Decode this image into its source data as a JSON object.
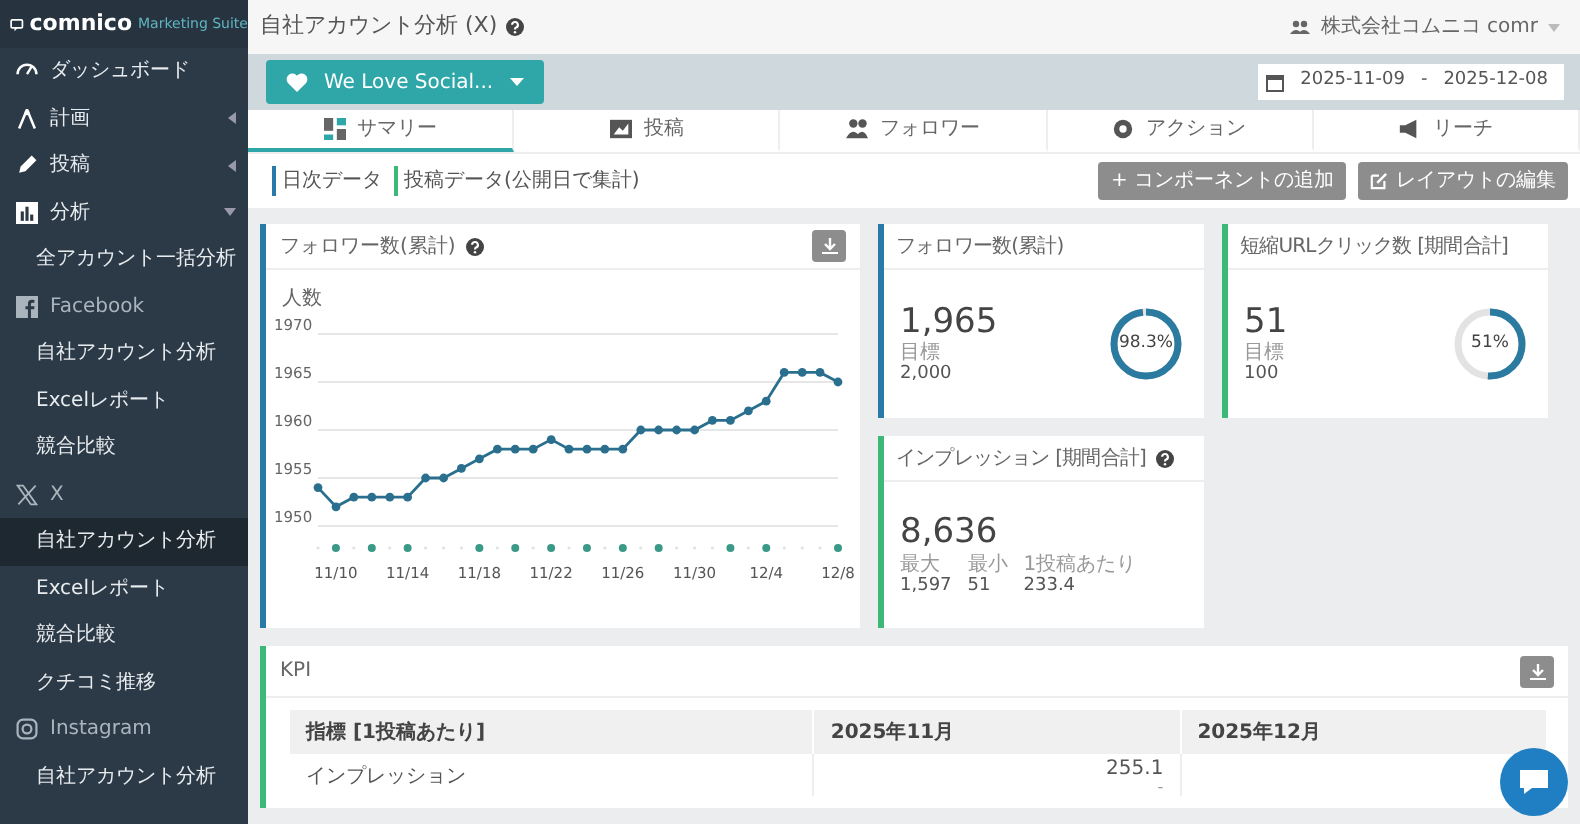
{
  "brand": {
    "name": "comnico",
    "product": "Marketing Suite"
  },
  "sidebar": {
    "items": [
      {
        "kind": "menu",
        "label": "ダッシュボード",
        "selected": false
      },
      {
        "kind": "menu",
        "label": "計画",
        "expanded": false,
        "selected": false
      },
      {
        "kind": "menu",
        "label": "投稿",
        "expanded": false,
        "selected": false
      },
      {
        "kind": "menu",
        "label": "分析",
        "expanded": true,
        "selected": false
      },
      {
        "kind": "sub",
        "label": "全アカウント一括分析",
        "selected": false
      },
      {
        "kind": "section",
        "label": "Facebook"
      },
      {
        "kind": "sub",
        "label": "自社アカウント分析",
        "selected": false
      },
      {
        "kind": "sub",
        "label": "Excelレポート",
        "selected": false
      },
      {
        "kind": "sub",
        "label": "競合比較",
        "selected": false
      },
      {
        "kind": "section",
        "label": "X"
      },
      {
        "kind": "sub",
        "label": "自社アカウント分析",
        "selected": true
      },
      {
        "kind": "sub",
        "label": "Excelレポート",
        "selected": false
      },
      {
        "kind": "sub",
        "label": "競合比較",
        "selected": false
      },
      {
        "kind": "sub",
        "label": "クチコミ推移",
        "selected": false
      },
      {
        "kind": "section",
        "label": "Instagram"
      },
      {
        "kind": "sub",
        "label": "自社アカウント分析",
        "selected": false
      }
    ]
  },
  "header": {
    "title": "自社アカウント分析 (X)",
    "company": "株式会社コムニコ comr"
  },
  "account_button": {
    "label": "We Love Social..."
  },
  "date_range": {
    "start": "2025-11-09",
    "separator": "-",
    "end": "2025-12-08"
  },
  "tabs": [
    {
      "label": "サマリー",
      "selected": true
    },
    {
      "label": "投稿",
      "selected": false
    },
    {
      "label": "フォロワー",
      "selected": false
    },
    {
      "label": "アクション",
      "selected": false
    },
    {
      "label": "リーチ",
      "selected": false
    }
  ],
  "legend": [
    {
      "label": "日次データ",
      "color": "#2a7aa8"
    },
    {
      "label": "投稿データ(公開日で集計)",
      "color": "#3cb878"
    }
  ],
  "actions": [
    {
      "kind": "add",
      "label": "+ コンポーネントの追加"
    },
    {
      "kind": "edit",
      "label": "レイアウトの編集"
    }
  ],
  "follower_chart": {
    "title": "フォロワー数(累計)",
    "color": "#2a7aa8",
    "posted": [
      false,
      true,
      false,
      true,
      false,
      true,
      false,
      false,
      false,
      true,
      false,
      true,
      false,
      true,
      false,
      true,
      false,
      true,
      false,
      true,
      false,
      false,
      false,
      true,
      false,
      true,
      false,
      false,
      false,
      true
    ],
    "chart_data": {
      "type": "line",
      "ylabel": "人数",
      "categories": [
        null,
        "11/10",
        null,
        null,
        null,
        "11/14",
        null,
        null,
        null,
        "11/18",
        null,
        null,
        null,
        "11/22",
        null,
        null,
        null,
        "11/26",
        null,
        null,
        null,
        "11/30",
        null,
        null,
        null,
        "12/4",
        null,
        null,
        null,
        "12/8"
      ],
      "series": [
        {
          "color": "#2a6f8e",
          "marker": true,
          "values": [
            1954,
            1952,
            1953,
            1953,
            1953,
            1953,
            1955,
            1955,
            1956,
            1957,
            1958,
            1958,
            1958,
            1959,
            1958,
            1958,
            1958,
            1958,
            1960,
            1960,
            1960,
            1960,
            1961,
            1961,
            1962,
            1963,
            1966,
            1966,
            1966,
            1965
          ]
        }
      ],
      "grid": true,
      "ylim": [
        1950,
        1970
      ],
      "yticks": [
        1950,
        1955,
        1960,
        1965,
        1970
      ]
    }
  },
  "metric_cards": [
    {
      "kind": "goal",
      "title": "フォロワー数(累計)",
      "color": "#2a7aa8",
      "value": "1,965",
      "stats": [
        {
          "label": "目標",
          "value": "2,000"
        }
      ],
      "level": 0.983,
      "percent": "98.3%",
      "help": false
    },
    {
      "kind": "goal",
      "title": "短縮URLクリック数 [期間合計]",
      "color": "#3cb878",
      "value": "51",
      "stats": [
        {
          "label": "目標",
          "value": "100"
        }
      ],
      "level": 0.51,
      "percent": "51%",
      "help": false
    },
    {
      "kind": "stats",
      "title": "インプレッション [期間合計]",
      "color": "#3cb878",
      "value": "8,636",
      "stats": [
        {
          "label": "最大",
          "value": "1,597"
        },
        {
          "label": "最小",
          "value": "51"
        },
        {
          "label": "1投稿あたり",
          "value": "233.4"
        }
      ],
      "help": true
    }
  ],
  "kpi": {
    "title": "KPI",
    "color": "#3cb878",
    "columns": [
      "指標 [1投稿あたり]",
      "2025年11月",
      "2025年12月"
    ],
    "rows": [
      {
        "metric": "インプレッション",
        "values": [
          {
            "value": "255.1",
            "change": "-"
          }
        ]
      }
    ]
  }
}
